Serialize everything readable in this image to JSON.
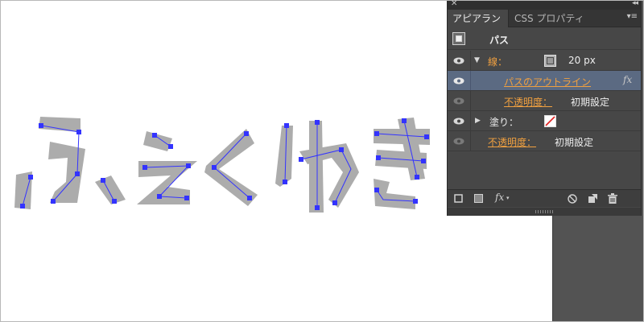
{
  "panel": {
    "tabs": [
      {
        "label": "アピアランス",
        "active": true
      },
      {
        "label": "CSS プロパティ",
        "active": false
      }
    ],
    "header": {
      "label": "パス"
    },
    "rows": {
      "stroke": {
        "label": "線：",
        "value": "20 px"
      },
      "effect": {
        "label": "パスのアウトライン",
        "fx": "fx"
      },
      "stroke_opacity": {
        "label": "不透明度：",
        "value": "初期設定"
      },
      "fill": {
        "label": "塗り："
      },
      "opacity": {
        "label": "不透明度：",
        "value": "初期設定"
      }
    },
    "toolbar": {
      "fx_label": "fx"
    }
  },
  "canvas": {
    "text": "ふえくゆき"
  },
  "colors": {
    "panel_bg": "#474747",
    "selection": "#5b6a82",
    "accent_orange": "#f0a040",
    "path_blue": "#3333ff",
    "shape_fill": "#aaaaaa",
    "pasteboard": "#535353"
  },
  "icons": [
    "close-icon",
    "collapse-icon",
    "panel-menu-icon",
    "eye-icon",
    "disclosure-triangle-icon",
    "stroke-swatch-icon",
    "fill-swatch-icon",
    "square-icon",
    "new-stroke-icon",
    "new-fill-icon",
    "fx-icon",
    "clear-icon",
    "duplicate-icon",
    "trash-icon",
    "resize-grip-icon"
  ]
}
